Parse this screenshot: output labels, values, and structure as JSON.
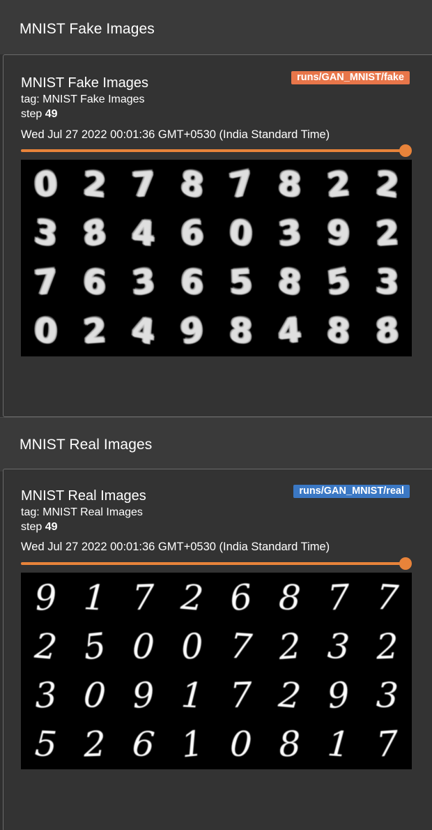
{
  "accent": "#e8833a",
  "sections": [
    {
      "header_title": "MNIST Fake Images",
      "card": {
        "title": "MNIST Fake Images",
        "tag_label": "tag:",
        "tag": "MNIST Fake Images",
        "step_label": "step",
        "step": "49",
        "date": "Wed Jul 27 2022 00:01:36 GMT+0530 (India Standard Time)",
        "run": "runs/GAN_MNIST/fake",
        "run_color": "#e8764a",
        "slider_value": 1.0,
        "image_alt": "grid of generated digit images",
        "digits": [
          [
            "0",
            "2",
            "7",
            "8",
            "7",
            "8",
            "2",
            "2"
          ],
          [
            "3",
            "8",
            "4",
            "6",
            "0",
            "3",
            "9",
            "2"
          ],
          [
            "7",
            "6",
            "3",
            "6",
            "5",
            "8",
            "5",
            "3"
          ],
          [
            "0",
            "2",
            "4",
            "9",
            "8",
            "4",
            "8",
            "8"
          ]
        ]
      }
    },
    {
      "header_title": "MNIST Real Images",
      "card": {
        "title": "MNIST Real Images",
        "tag_label": "tag:",
        "tag": "MNIST Real Images",
        "step_label": "step",
        "step": "49",
        "date": "Wed Jul 27 2022 00:01:36 GMT+0530 (India Standard Time)",
        "run": "runs/GAN_MNIST/real",
        "run_color": "#3b78c4",
        "slider_value": 1.0,
        "image_alt": "grid of real digit images",
        "digits": [
          [
            "9",
            "1",
            "7",
            "2",
            "6",
            "8",
            "7",
            "7"
          ],
          [
            "2",
            "5",
            "0",
            "0",
            "7",
            "2",
            "3",
            "2"
          ],
          [
            "3",
            "0",
            "9",
            "1",
            "7",
            "2",
            "9",
            "3"
          ],
          [
            "5",
            "2",
            "6",
            "1",
            "0",
            "8",
            "1",
            "7"
          ]
        ]
      }
    }
  ]
}
